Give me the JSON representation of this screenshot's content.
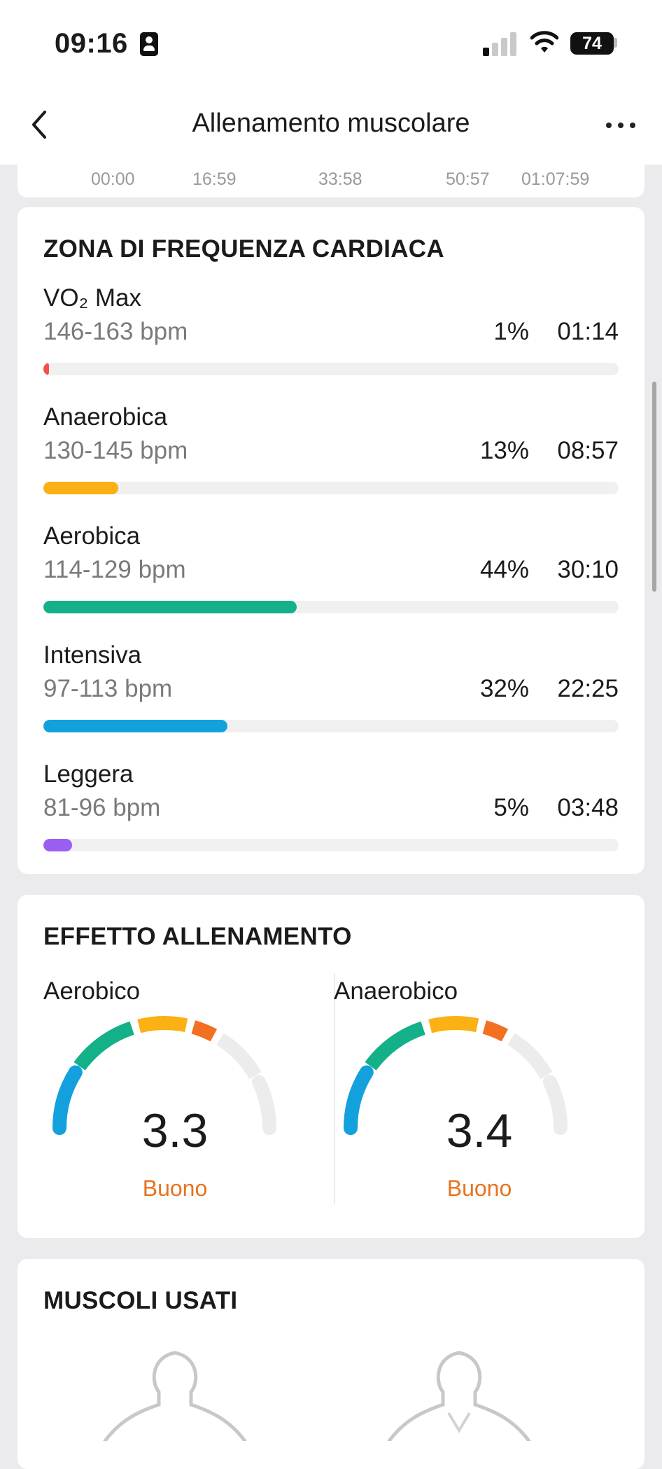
{
  "status_bar": {
    "time": "09:16",
    "battery": "74",
    "icons": [
      "contact-card-icon",
      "signal-icon",
      "wifi-icon",
      "battery-icon"
    ]
  },
  "nav": {
    "title": "Allenamento muscolare",
    "back_icon": "chevron-left-icon",
    "more_icon": "more-horizontal-icon"
  },
  "timeline": {
    "ticks": [
      "00:00",
      "16:59",
      "33:58",
      "50:57",
      "01:07:59"
    ]
  },
  "heart_rate_zones": {
    "title": "ZONA DI FREQUENZA CARDIACA",
    "zones": [
      {
        "name": "VO₂ Max",
        "range": "146-163 bpm",
        "percent": "1%",
        "duration": "01:14",
        "fraction": 0.01,
        "color": "#f2504b"
      },
      {
        "name": "Anaerobica",
        "range": "130-145 bpm",
        "percent": "13%",
        "duration": "08:57",
        "fraction": 0.13,
        "color": "#fbb014"
      },
      {
        "name": "Aerobica",
        "range": "114-129 bpm",
        "percent": "44%",
        "duration": "30:10",
        "fraction": 0.44,
        "color": "#13b089"
      },
      {
        "name": "Intensiva",
        "range": "97-113 bpm",
        "percent": "32%",
        "duration": "22:25",
        "fraction": 0.32,
        "color": "#12a1dd"
      },
      {
        "name": "Leggera",
        "range": "81-96 bpm",
        "percent": "5%",
        "duration": "03:48",
        "fraction": 0.05,
        "color": "#9a5ef0"
      }
    ]
  },
  "training_effect": {
    "title": "EFFETTO ALLENAMENTO",
    "aerobic": {
      "label": "Aerobico",
      "value": "3.3",
      "status": "Buono",
      "level": 3.3
    },
    "anaerobic": {
      "label": "Anaerobico",
      "value": "3.4",
      "status": "Buono",
      "level": 3.4
    },
    "gauge_colors": [
      "#12a1dd",
      "#13b089",
      "#fbb014",
      "#f36f21",
      "#ececec"
    ],
    "status_color": "#e8731f"
  },
  "muscles": {
    "title": "MUSCOLI USATI",
    "icons": [
      "body-front-icon",
      "body-back-icon"
    ]
  }
}
